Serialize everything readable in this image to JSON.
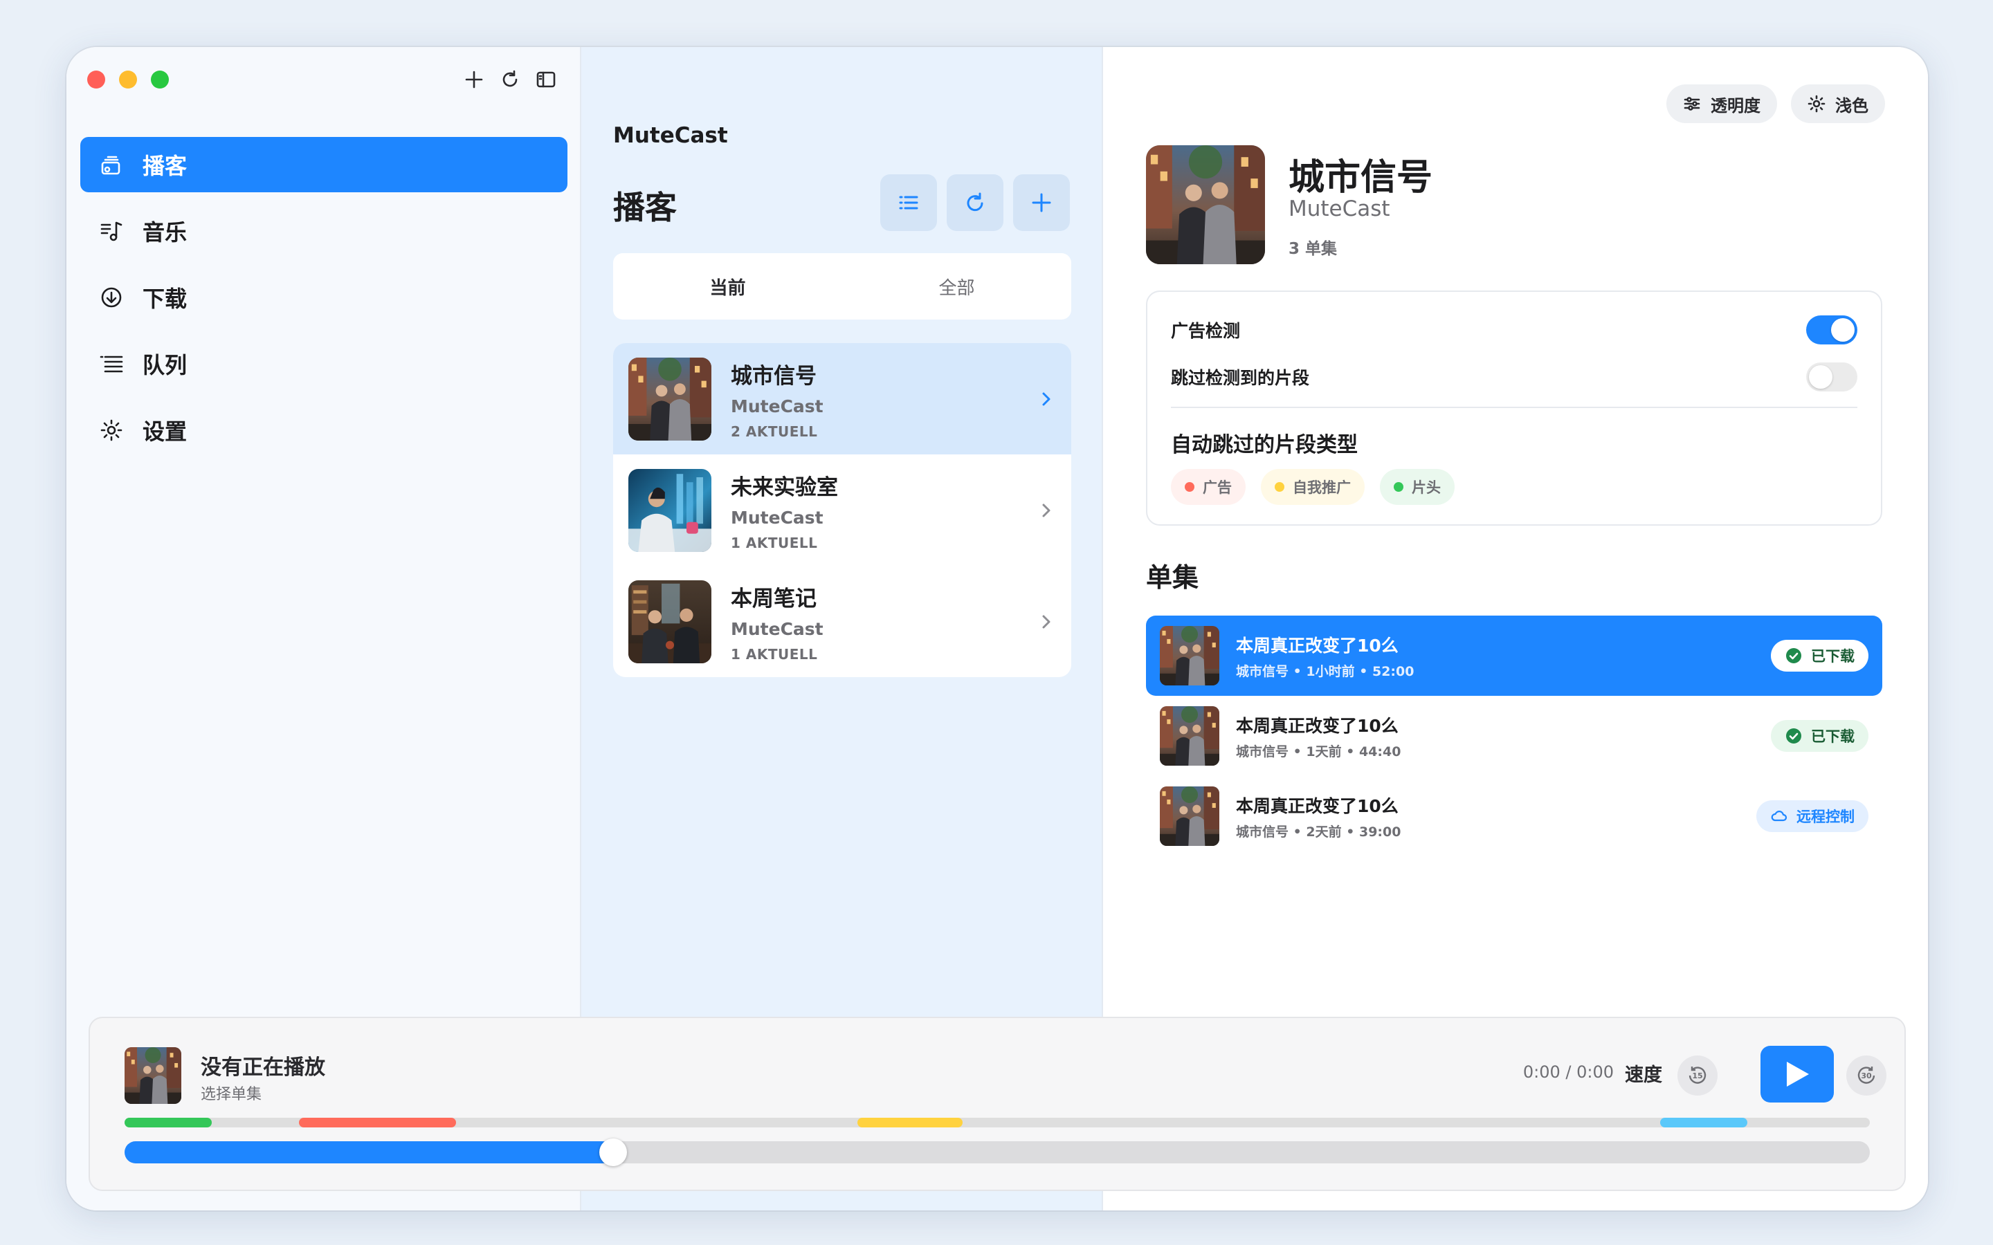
{
  "window": {
    "toolbar": {
      "add_icon": "plus-icon",
      "refresh_icon": "refresh-icon",
      "sidebar_icon": "sidebar-toggle-icon"
    }
  },
  "sidebar": {
    "items": [
      {
        "label": "播客",
        "icon": "podcast-icon",
        "active": true
      },
      {
        "label": "音乐",
        "icon": "music-icon",
        "active": false
      },
      {
        "label": "下载",
        "icon": "download-icon",
        "active": false
      },
      {
        "label": "队列",
        "icon": "queue-icon",
        "active": false
      },
      {
        "label": "设置",
        "icon": "gear-icon",
        "active": false
      }
    ]
  },
  "middle": {
    "app_name": "MuteCast",
    "title": "播客",
    "tabs": [
      {
        "label": "当前",
        "active": true
      },
      {
        "label": "全部",
        "active": false
      }
    ],
    "podcasts": [
      {
        "title": "城市信号",
        "author": "MuteCast",
        "count": "2 AKTUELL",
        "selected": true
      },
      {
        "title": "未来实验室",
        "author": "MuteCast",
        "count": "1 AKTUELL",
        "selected": false
      },
      {
        "title": "本周笔记",
        "author": "MuteCast",
        "count": "1 AKTUELL",
        "selected": false
      }
    ]
  },
  "detail": {
    "opacity_label": "透明度",
    "theme_label": "浅色",
    "podcast_title": "城市信号",
    "podcast_author": "MuteCast",
    "episode_count": "3 单集",
    "settings": {
      "ad_detection_label": "广告检测",
      "ad_detection_on": true,
      "skip_detected_label": "跳过检测到的片段",
      "skip_detected_on": false,
      "segment_types_title": "自动跳过的片段类型",
      "chips": [
        {
          "label": "广告",
          "color": "#ff6b5b",
          "bg": "#fff1ef"
        },
        {
          "label": "自我推广",
          "color": "#ffd23f",
          "bg": "#fff9e6"
        },
        {
          "label": "片头",
          "color": "#34c759",
          "bg": "#eaf8ee"
        }
      ]
    },
    "episodes_title": "单集",
    "episodes": [
      {
        "title": "本周真正改变了10么",
        "meta": "城市信号 • 1小时前 • 52:00",
        "badge": "已下载",
        "badge_type": "downloaded",
        "active": true
      },
      {
        "title": "本周真正改变了10么",
        "meta": "城市信号 • 1天前 • 44:40",
        "badge": "已下载",
        "badge_type": "downloaded",
        "active": false
      },
      {
        "title": "本周真正改变了10么",
        "meta": "城市信号 • 2天前 • 39:00",
        "badge": "远程控制",
        "badge_type": "remote",
        "active": false
      }
    ]
  },
  "player": {
    "title": "没有正在播放",
    "subtitle": "选择单集",
    "time": "0:00 / 0:00",
    "speed_label": "速度",
    "skip_back": "15",
    "skip_forward": "30",
    "progress": 0.28,
    "segments": [
      {
        "start": 0.0,
        "end": 0.05,
        "color": "#34c759"
      },
      {
        "start": 0.1,
        "end": 0.19,
        "color": "#ff6b5b"
      },
      {
        "start": 0.42,
        "end": 0.48,
        "color": "#ffd23f"
      },
      {
        "start": 0.88,
        "end": 0.93,
        "color": "#5ac8fa"
      }
    ]
  }
}
